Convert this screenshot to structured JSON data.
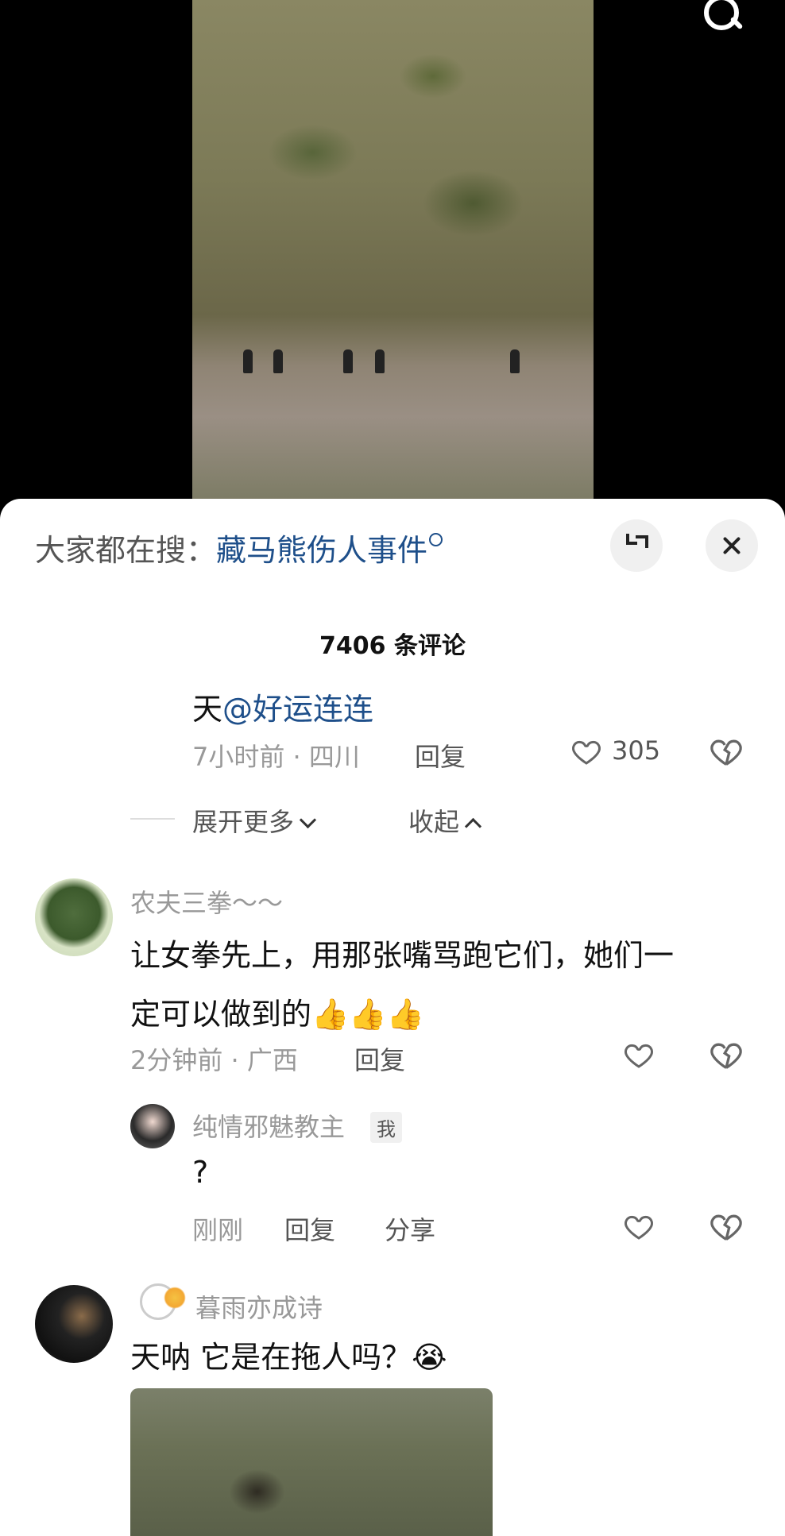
{
  "top_search_icon": "search-icon",
  "hot_search": {
    "prefix": "大家都在搜：",
    "keyword": "藏马熊伤人事件"
  },
  "comment_count": "7406 条评论",
  "reply_thread": {
    "text_prefix": "天",
    "mention": "@好运连连",
    "meta": "7小时前 · 四川",
    "reply": "回复",
    "likes": "305",
    "expand": "展开更多",
    "collapse": "收起"
  },
  "comment1": {
    "user": "农夫三拳～～",
    "line1": "让女拳先上，用那张嘴骂跑它们，她们一",
    "line2": "定可以做到的",
    "emoji": "👍👍👍",
    "meta": "2分钟前 · 广西",
    "reply": "回复"
  },
  "reply1": {
    "user": "纯情邪魅教主",
    "badge": "我",
    "text": "?",
    "time": "刚刚",
    "reply": "回复",
    "share": "分享"
  },
  "comment2": {
    "user": "暮雨亦成诗",
    "text": "天呐 它是在拖人吗？",
    "emoji": "😭"
  },
  "colors": {
    "link": "#1e4f8a",
    "muted": "#999999",
    "text": "#111111"
  }
}
